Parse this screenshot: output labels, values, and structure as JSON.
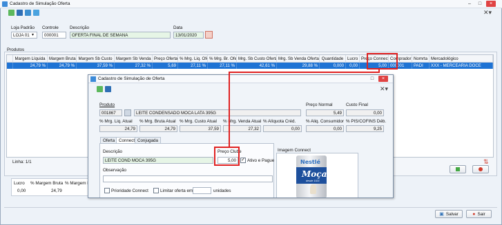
{
  "window": {
    "title": "Cadastro de Simulação Oferta"
  },
  "header": {
    "loja_label": "Loja Padrão",
    "loja_value": "LOJA 01",
    "controle_label": "Controle",
    "controle_value": "000001",
    "descricao_label": "Descrição",
    "descricao_value": "OFERTA FINAL DE SEMANA",
    "data_label": "Data",
    "data_value": "13/01/2020"
  },
  "produtos": {
    "group_label": "Produtos",
    "columns": [
      "Margem Líquida",
      "Margem Bruta",
      "Margem Sb Custo",
      "Margem Sb Venda",
      "Preço Oferta",
      "% Mrg. Liq. Ofer",
      "% Mrg. Br. Ofer",
      "Mrg. Sb Custo Oferta",
      "Mrg. Sb Venda Oferta",
      "Quantidade",
      "Lucro",
      "Preço Connect",
      "Comprador",
      "Nomrta",
      "Mercadológico"
    ],
    "row": [
      "24,79 %",
      "24,79 %",
      "37,59 %",
      "27,32 %",
      "5,69",
      "27,11 %",
      "27,11 %",
      "42,61 %",
      "29,88 %",
      "0,000",
      "0,00",
      "5,00",
      "000001",
      "PADI",
      "XXX - MERCEARIA DOCE"
    ],
    "linha": "Linha: 1/1"
  },
  "totals": {
    "columns": [
      "Lucro",
      "% Margem Bruta",
      "% Margem L"
    ],
    "values": [
      "0,00",
      "24,79",
      ""
    ]
  },
  "footer": {
    "salvar": "Salvar",
    "sair": "Sair"
  },
  "dialog": {
    "title": "Cadastro de Simulação de Oferta",
    "produto_label": "Produto",
    "produto_code": "001867",
    "produto_desc": "LEITE CONDENSADO MOCA LATA 395G",
    "preco_normal_label": "Preço Normal",
    "preco_normal": "5,49",
    "custo_final_label": "Custo Final",
    "custo_final": "0,00",
    "row2_labels": [
      "% Mrg. Liq. Atual",
      "% Mrg. Bruta Atual",
      "% Mrg. Custo Atual",
      "% Mrg. Venda Atual",
      "% Alíquota Créd.",
      "% Aliq. Consumidor",
      "% PIS/COFINS Déb."
    ],
    "row2_values": [
      "24,79",
      "24,79",
      "37,59",
      "27,32",
      "0,00",
      "0,00",
      "9,25"
    ],
    "tabs": [
      "Oferta",
      "Connect",
      "Conjugada"
    ],
    "descricao_label": "Descrição",
    "descricao_value": "LEITE COND MOCA 395G",
    "preco_clube_label": "Preço Clube",
    "preco_clube_value": "5,00",
    "ativo_label": "Ativo e Pague",
    "observacao_label": "Observação",
    "prioridade_label": "Prioridade Connect",
    "limitar_label": "Limitar oferta em:",
    "unidades_label": "unidades",
    "imagem_label": "Imagem Connect",
    "image_brand": "Nestlé",
    "image_product": "Moça",
    "image_tagline": "desde 1921"
  }
}
